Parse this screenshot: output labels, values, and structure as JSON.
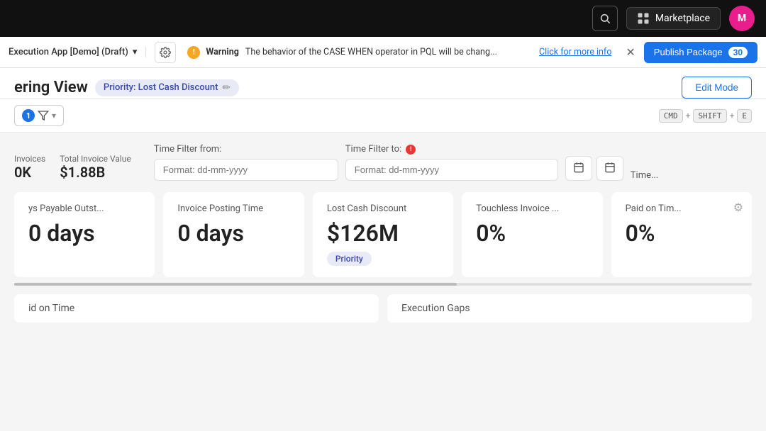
{
  "navbar": {
    "marketplace_label": "Marketplace",
    "avatar_initials": "M",
    "avatar_color": "#e91e8c"
  },
  "warning_bar": {
    "app_name": "Execution App [Demo] (Draft)",
    "warning_label": "Warning",
    "warning_text": "The behavior of the CASE WHEN operator in PQL will be chang...",
    "warning_link": "Click for more info",
    "publish_label": "Publish Package",
    "publish_count": "30"
  },
  "page": {
    "title": "ering View",
    "priority_badge": "Priority: Lost Cash Discount",
    "edit_mode_label": "Edit Mode"
  },
  "toolbar": {
    "filter_count": "1",
    "shortcut_cmd": "CMD",
    "shortcut_shift": "SHIFT",
    "shortcut_e": "E"
  },
  "time_filters": {
    "from_label": "Time Filter from:",
    "from_placeholder": "Format: dd-mm-yyyy",
    "to_label": "Time Filter to:",
    "to_placeholder": "Format: dd-mm-yyyy",
    "time_label": "Time..."
  },
  "kpi_summary": {
    "invoices_label": "Invoices",
    "invoices_value": "0K",
    "total_invoice_label": "Total Invoice Value",
    "total_invoice_value": "$1.88B"
  },
  "metric_cards": [
    {
      "id": "days-payable",
      "label": "ys Payable Outst...",
      "value": "0 days",
      "badge": null,
      "has_gear": false
    },
    {
      "id": "invoice-posting-time",
      "label": "Invoice Posting Time",
      "value": "0 days",
      "badge": null,
      "has_gear": false
    },
    {
      "id": "lost-cash-discount",
      "label": "Lost Cash Discount",
      "value": "$126M",
      "badge": "Priority",
      "has_gear": false
    },
    {
      "id": "touchless-invoice",
      "label": "Touchless Invoice ...",
      "value": "0%",
      "badge": null,
      "has_gear": false
    },
    {
      "id": "paid-on-time",
      "label": "Paid on Tim...",
      "value": "0%",
      "badge": null,
      "has_gear": true
    }
  ],
  "bottom_sections": [
    {
      "label": "id on Time"
    },
    {
      "label": "Execution Gaps"
    }
  ]
}
